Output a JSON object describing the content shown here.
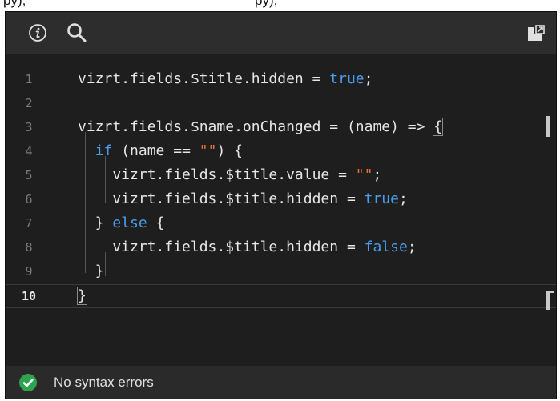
{
  "top_strip": {
    "left_text": "py),",
    "right_text": "py),"
  },
  "toolbar": {
    "info_icon": "info-icon",
    "search_icon": "search-icon",
    "popout_icon": "popout-icon"
  },
  "editor": {
    "current_line": 10,
    "lines": [
      {
        "number": "1",
        "text": "vizrt.fields.$title.hidden = true;"
      },
      {
        "number": "2",
        "text": ""
      },
      {
        "number": "3",
        "text": "vizrt.fields.$name.onChanged = (name) => {"
      },
      {
        "number": "4",
        "text": "  if (name == \"\") {"
      },
      {
        "number": "5",
        "text": "    vizrt.fields.$title.value = \"\";"
      },
      {
        "number": "6",
        "text": "    vizrt.fields.$title.hidden = true;"
      },
      {
        "number": "7",
        "text": "  } else {"
      },
      {
        "number": "8",
        "text": "    vizrt.fields.$title.hidden = false;"
      },
      {
        "number": "9",
        "text": "  }"
      },
      {
        "number": "10",
        "text": "}"
      }
    ]
  },
  "status": {
    "icon": "check-circle-icon",
    "text": "No syntax errors",
    "color": "#2ea44f"
  },
  "colors": {
    "keyword": "#4a9eea",
    "string": "#e6703a",
    "text": "#e6e6e6",
    "background": "#1e1e1e"
  }
}
